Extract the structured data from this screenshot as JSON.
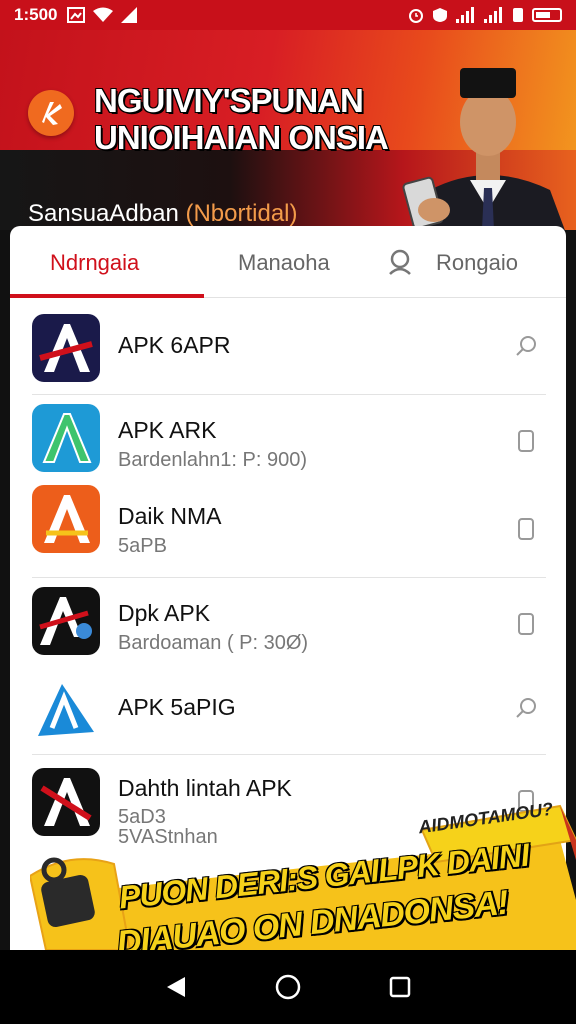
{
  "status_bar": {
    "time": "1:500"
  },
  "hero": {
    "title_line1": "NGUIVIY'SPUNAN",
    "title_line2": "UNIOIHAIAN ONSIA",
    "subtitle_main": "SansuaAdban",
    "subtitle_paren": "(Nbortidal)"
  },
  "tabs": [
    {
      "label": "Ndrngaia",
      "active": true
    },
    {
      "label": "Manaoha",
      "active": false
    },
    {
      "label": "Rongaio",
      "active": false
    }
  ],
  "apps": [
    {
      "title": "APK 6APR",
      "subtitle": "",
      "action": "search-icon",
      "icon_color": "#1a1a4a"
    },
    {
      "title": "APK ARK",
      "subtitle": "Bardenlahn1: P: 900)",
      "action": "phone-icon",
      "icon_color": "#1e9ad6"
    },
    {
      "title": "Daik NMA",
      "subtitle": "5aPB",
      "action": "phone-icon",
      "icon_color": "#f07a1c"
    },
    {
      "title": "Dpk APK",
      "subtitle": "Bardoaman ( P: 30Ø)",
      "action": "phone-icon",
      "icon_color": "#111111"
    },
    {
      "title": "APK 5aPIG",
      "subtitle": "",
      "action": "search-icon",
      "icon_color": "#1a8ad8"
    },
    {
      "title": "Dahth lintah APK",
      "subtitle": "5aD3\n5VAStnhan",
      "action": "phone-icon",
      "icon_color": "#111111"
    }
  ],
  "promo": {
    "tag": "AIDMOTAMOU?",
    "line1": "PUON DERI:S GAILPK DAINI",
    "line2": "DIAUAO ON DNADONSA!"
  },
  "colors": {
    "brand_red": "#d0101b",
    "accent_orange": "#f39b1f",
    "promo_yellow": "#f6d21a"
  }
}
